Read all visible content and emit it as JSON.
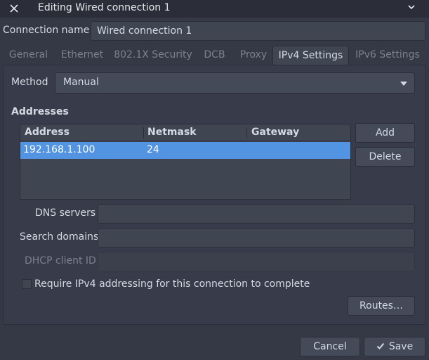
{
  "window": {
    "title": "Editing Wired connection 1"
  },
  "connection": {
    "name_label": "Connection name",
    "name_value": "Wired connection 1"
  },
  "tabs": [
    {
      "label": "General"
    },
    {
      "label": "Ethernet"
    },
    {
      "label": "802.1X Security"
    },
    {
      "label": "DCB"
    },
    {
      "label": "Proxy"
    },
    {
      "label": "IPv4 Settings"
    },
    {
      "label": "IPv6 Settings"
    }
  ],
  "active_tab": "IPv4 Settings",
  "method": {
    "label": "Method",
    "value": "Manual"
  },
  "addresses": {
    "title": "Addresses",
    "columns": [
      "Address",
      "Netmask",
      "Gateway"
    ],
    "rows": [
      {
        "address": "192.168.1.100",
        "netmask": "24",
        "gateway": ""
      }
    ],
    "add_label": "Add",
    "delete_label": "Delete"
  },
  "fields": {
    "dns_label": "DNS servers",
    "dns_value": "",
    "search_label": "Search domains",
    "search_value": "",
    "dhcp_label": "DHCP client ID",
    "dhcp_value": ""
  },
  "require_ipv4": {
    "label": "Require IPv4 addressing for this connection to complete",
    "checked": false
  },
  "routes_label": "Routes…",
  "footer": {
    "cancel_label": "Cancel",
    "save_label": "Save"
  },
  "colors": {
    "background": "#353945",
    "selection": "#5294e2",
    "text": "#d3dae3",
    "disabled_text": "#7c818c"
  }
}
